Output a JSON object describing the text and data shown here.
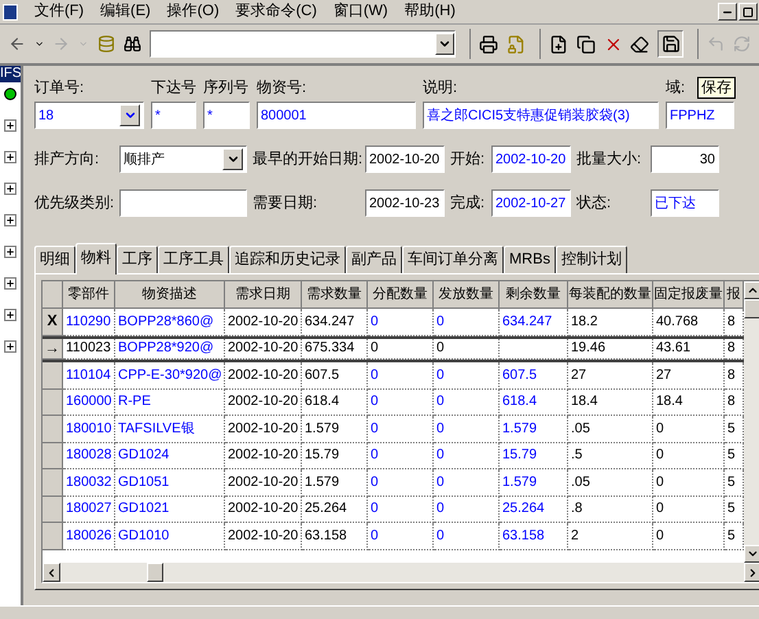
{
  "menu": [
    "文件(F)",
    "编辑(E)",
    "操作(O)",
    "要求命令(C)",
    "窗口(W)",
    "帮助(H)"
  ],
  "toolbar": {
    "tooltip": "保存"
  },
  "left_panel": {
    "header": "IFS"
  },
  "form": {
    "row1": [
      {
        "label": "订单号:",
        "value": "18",
        "kind": "combo",
        "readonly": true
      },
      {
        "label": "下达号",
        "value": "*",
        "kind": "field",
        "readonly": true
      },
      {
        "label": "序列号",
        "value": "*",
        "kind": "field",
        "readonly": true
      },
      {
        "label": "物资号:",
        "value": "800001",
        "kind": "field",
        "readonly": true
      },
      {
        "label": "说明:",
        "value": "喜之郎CICI5支特惠促销装胶袋(3)",
        "kind": "field",
        "readonly": true
      },
      {
        "label": "域:",
        "value": "FPPHZ",
        "kind": "field",
        "readonly": true
      }
    ],
    "rows": [
      [
        {
          "label": "排产方向:",
          "value": "顺排产",
          "kind": "combo",
          "readonly": false
        },
        {
          "label": "最早的开始日期:",
          "value": "2002-10-20",
          "kind": "field",
          "readonly": false
        },
        {
          "label": "开始:",
          "value": "2002-10-20",
          "kind": "field",
          "readonly": true
        },
        {
          "label": "批量大小:",
          "value": "30",
          "kind": "number",
          "readonly": false
        }
      ],
      [
        {
          "label": "优先级类别:",
          "kind": "field"
        },
        {
          "label": "需要日期:",
          "value": "2002-10-23",
          "kind": "field",
          "readonly": false
        },
        {
          "label": "完成:",
          "value": "2002-10-27",
          "kind": "field",
          "readonly": true
        },
        {
          "label": "状态:",
          "value": "已下达",
          "kind": "field",
          "readonly": true
        }
      ]
    ]
  },
  "tabs": [
    {
      "label": "明细",
      "selected": false
    },
    {
      "label": "物料",
      "selected": true
    },
    {
      "label": "工序",
      "selected": false
    },
    {
      "label": "工序工具",
      "selected": false
    },
    {
      "label": "追踪和历史记录",
      "selected": false
    },
    {
      "label": "副产品",
      "selected": false
    },
    {
      "label": "车间订单分离",
      "selected": false
    },
    {
      "label": "MRBs",
      "selected": false
    },
    {
      "label": "控制计划",
      "selected": false
    }
  ],
  "table": {
    "columns": [
      {
        "label": "零部件",
        "readonly": true
      },
      {
        "label": "物资描述",
        "readonly": true
      },
      {
        "label": "需求日期",
        "readonly": false
      },
      {
        "label": "需求数量",
        "readonly": false
      },
      {
        "label": "分配数量",
        "readonly": true
      },
      {
        "label": "发放数量",
        "readonly": true
      },
      {
        "label": "剩余数量",
        "readonly": true
      },
      {
        "label": "每装配的数量",
        "readonly": false
      },
      {
        "label": "固定报废量",
        "readonly": false
      },
      {
        "label": "报",
        "readonly": false
      }
    ],
    "rows": [
      {
        "marker": "X",
        "selected": false,
        "cells": [
          "110290",
          "BOPP28*860@",
          "2002-10-20",
          "634.247",
          "0",
          "0",
          "634.247",
          "18.2",
          "40.768",
          "8"
        ]
      },
      {
        "marker": "→",
        "selected": true,
        "cells": [
          "110023",
          "BOPP28*920@",
          "2002-10-20",
          "675.334",
          "0",
          "0",
          "",
          "19.46",
          "43.61",
          "8"
        ]
      },
      {
        "selected": false,
        "cells": [
          "110104",
          "CPP-E-30*920@",
          "2002-10-20",
          "607.5",
          "0",
          "0",
          "607.5",
          "27",
          "27",
          "8"
        ]
      },
      {
        "selected": false,
        "cells": [
          "160000",
          "R-PE",
          "2002-10-20",
          "618.4",
          "0",
          "0",
          "618.4",
          "18.4",
          "18.4",
          "8"
        ]
      },
      {
        "selected": false,
        "cells": [
          "180010",
          "TAFSILVE银",
          "2002-10-20",
          "1.579",
          "0",
          "0",
          "1.579",
          ".05",
          "0",
          "5"
        ]
      },
      {
        "selected": false,
        "cells": [
          "180028",
          "GD1024",
          "2002-10-20",
          "15.79",
          "0",
          "0",
          "15.79",
          ".5",
          "0",
          "5"
        ]
      },
      {
        "selected": false,
        "cells": [
          "180032",
          "GD1051",
          "2002-10-20",
          "1.579",
          "0",
          "0",
          "1.579",
          ".05",
          "0",
          "5"
        ]
      },
      {
        "selected": false,
        "cells": [
          "180027",
          "GD1021",
          "2002-10-20",
          "25.264",
          "0",
          "0",
          "25.264",
          ".8",
          "0",
          "5"
        ]
      },
      {
        "selected": false,
        "cells": [
          "180026",
          "GD1010",
          "2002-10-20",
          "63.158",
          "0",
          "0",
          "63.158",
          "2",
          "0",
          "5"
        ]
      }
    ]
  }
}
